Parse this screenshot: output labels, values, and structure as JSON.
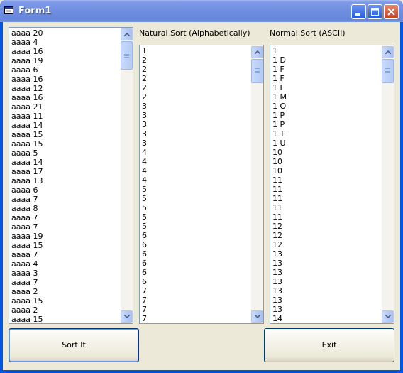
{
  "window": {
    "title": "Form1"
  },
  "lists": {
    "unsorted": {
      "items": [
        "aaaa 20",
        "aaaa 4",
        "aaaa 16",
        "aaaa 19",
        "aaaa 6",
        "aaaa 16",
        "aaaa 12",
        "aaaa 16",
        "aaaa 21",
        "aaaa 11",
        "aaaa 14",
        "aaaa 15",
        "aaaa 15",
        "aaaa 5",
        "aaaa 14",
        "aaaa 17",
        "aaaa 13",
        "aaaa 6",
        "aaaa 7",
        "aaaa 8",
        "aaaa 7",
        "aaaa 7",
        "aaaa 19",
        "aaaa 15",
        "aaaa 7",
        "aaaa 4",
        "aaaa 3",
        "aaaa 7",
        "aaaa 2",
        "aaaa 15",
        "aaaa 2",
        "aaaa 15"
      ]
    },
    "natural": {
      "label": "Natural Sort (Alphabetically)",
      "items": [
        "1",
        "2",
        "2",
        "2",
        "2",
        "2",
        "3",
        "3",
        "3",
        "3",
        "3",
        "4",
        "4",
        "4",
        "4",
        "5",
        "5",
        "5",
        "5",
        "5",
        "6",
        "6",
        "6",
        "6",
        "6",
        "6",
        "7",
        "7",
        "7",
        "7"
      ]
    },
    "normal": {
      "label": "Normal Sort (ASCII)",
      "items": [
        "1",
        "1 D",
        "1 F",
        "1 F",
        "1 I",
        "1 M",
        "1 O",
        "1 P",
        "1 P",
        "1 T",
        "1 U",
        "10",
        "10",
        "10",
        "11",
        "11",
        "11",
        "11",
        "11",
        "12",
        "12",
        "12",
        "13",
        "13",
        "13",
        "13",
        "13",
        "13",
        "13",
        "14"
      ]
    }
  },
  "buttons": {
    "sort": "Sort It",
    "exit": "Exit"
  }
}
